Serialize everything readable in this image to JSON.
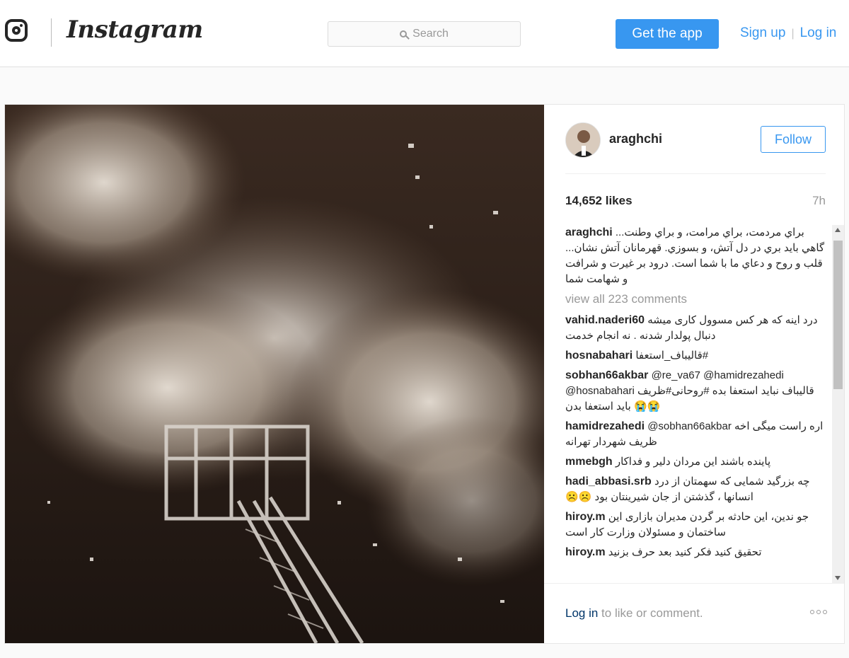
{
  "header": {
    "wordmark": "Instagram",
    "search_placeholder": "Search",
    "get_app_label": "Get the app",
    "sign_up_label": "Sign up",
    "divider": "|",
    "log_in_label": "Log in"
  },
  "post": {
    "username": "araghchi",
    "follow_label": "Follow",
    "likes": "14,652 likes",
    "age": "7h",
    "caption": {
      "user": "araghchi",
      "text": "براي مردمت، براي مرامت، و براي وطنت... گاهي بايد بري در دل آتش، و بسوزي. قهرمانان آتش نشان... قلب و روح و دعاي ما با شما است. درود بر غيرت و شرافت و شهامت شما"
    },
    "view_all_comments": "view all 223 comments",
    "comments": [
      {
        "user": "vahid.naderi60",
        "text": "درد اینه که هر کس مسوول کاری میشه دنبال پولدار شدنه . نه انجام خدمت"
      },
      {
        "user": "hosnabahari",
        "text": "#قالیباف_استعفا"
      },
      {
        "user": "sobhan66akbar",
        "text": "@re_va67 @hamidrezahedi @hosnabahari قالیباف نباید استعفا بده #روحانی#ظریف باید استعفا بدن 😭😭"
      },
      {
        "user": "hamidrezahedi",
        "text": "@sobhan66akbar اره راست میگی اخه ظریف شهردار تهرانه"
      },
      {
        "user": "mmebgh",
        "text": "پاینده باشند این مردان دلیر و فداکار"
      },
      {
        "user": "hadi_abbasi.srb",
        "text": "چه بزرگید شمایی که سهمتان از درد انسانها ، گذشتن از جان شیرینتان بود ☹️☹️"
      },
      {
        "user": "hiroy.m",
        "text": "جو ندین، این حادثه بر گردن مدیران بازاری این ساختمان و مسئولان وزارت کار است"
      },
      {
        "user": "hiroy.m",
        "text": "تحقیق کنید فکر کنید بعد حرف بزنید"
      }
    ],
    "login_prompt_link": "Log in",
    "login_prompt_text": " to like or comment."
  },
  "colors": {
    "accent": "#3897f0",
    "text": "#262626",
    "muted": "#999999"
  }
}
